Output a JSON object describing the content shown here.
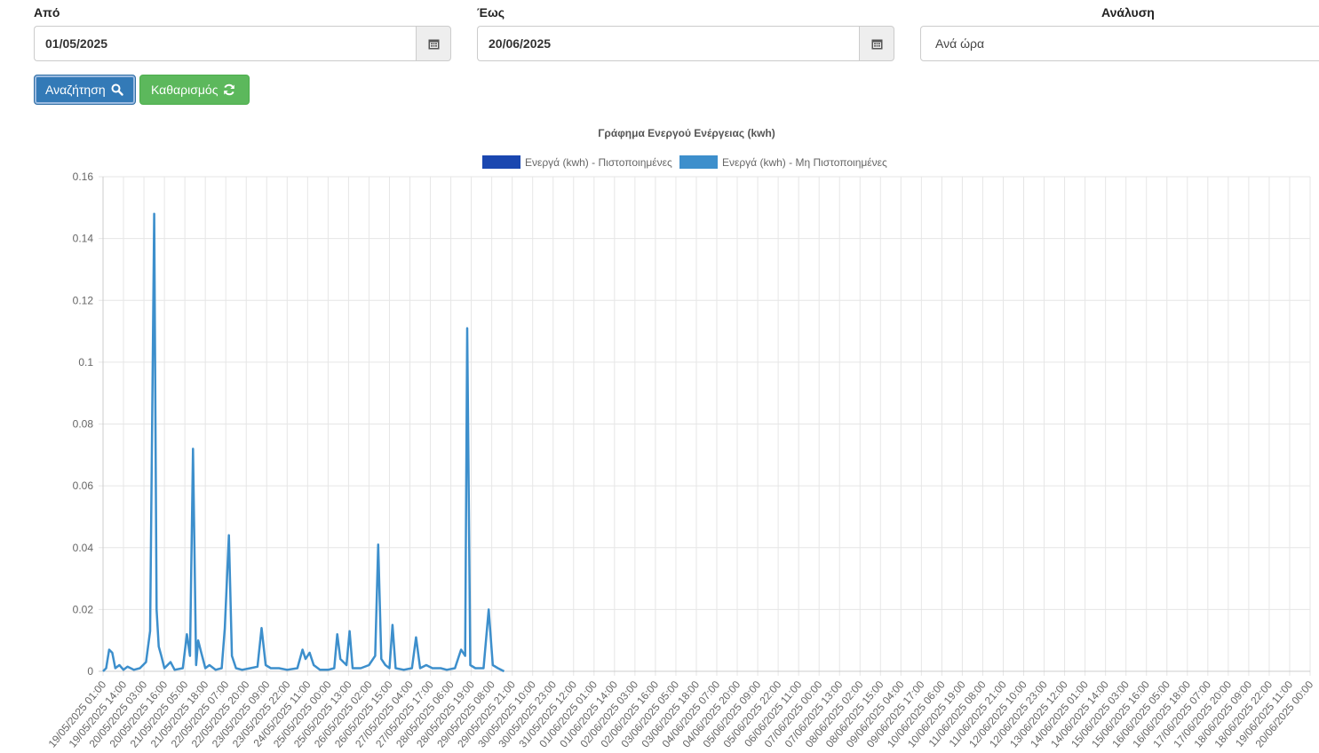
{
  "filters": {
    "from_label": "Από",
    "from_value": "01/05/2025",
    "to_label": "Έως",
    "to_value": "20/06/2025",
    "analysis_label": "Ανάλυση",
    "analysis_value": "Ανά ώρα"
  },
  "buttons": {
    "search_label": "Αναζήτηση",
    "clear_label": "Καθαρισμός"
  },
  "icons": [
    "calendar-icon",
    "search-icon",
    "refresh-icon"
  ],
  "chart_data": {
    "type": "line",
    "title": "Γράφημα Ενεργού Ενέργειας (kwh)",
    "legend_position": "top",
    "grid": true,
    "ylim": [
      0,
      0.16
    ],
    "yticks": [
      0,
      0.02,
      0.04,
      0.06,
      0.08,
      0.1,
      0.12,
      0.14,
      0.16
    ],
    "categories": [
      "19/05/2025 01:00",
      "19/05/2025 14:00",
      "20/05/2025 03:00",
      "20/05/2025 16:00",
      "21/05/2025 05:00",
      "21/05/2025 18:00",
      "22/05/2025 07:00",
      "22/05/2025 20:00",
      "23/05/2025 09:00",
      "23/05/2025 22:00",
      "24/05/2025 11:00",
      "25/05/2025 00:00",
      "25/05/2025 13:00",
      "26/05/2025 02:00",
      "26/05/2025 15:00",
      "27/05/2025 04:00",
      "27/05/2025 17:00",
      "28/05/2025 06:00",
      "28/05/2025 19:00",
      "29/05/2025 08:00",
      "29/05/2025 21:00",
      "30/05/2025 10:00",
      "30/05/2025 23:00",
      "31/05/2025 12:00",
      "01/06/2025 01:00",
      "01/06/2025 14:00",
      "02/06/2025 03:00",
      "02/06/2025 16:00",
      "03/06/2025 05:00",
      "03/06/2025 18:00",
      "04/06/2025 07:00",
      "04/06/2025 20:00",
      "05/06/2025 09:00",
      "05/06/2025 22:00",
      "06/06/2025 11:00",
      "07/06/2025 00:00",
      "07/06/2025 13:00",
      "08/06/2025 02:00",
      "08/06/2025 15:00",
      "09/06/2025 04:00",
      "09/06/2025 17:00",
      "10/06/2025 06:00",
      "10/06/2025 19:00",
      "11/06/2025 08:00",
      "11/06/2025 21:00",
      "12/06/2025 10:00",
      "12/06/2025 23:00",
      "13/06/2025 12:00",
      "14/06/2025 01:00",
      "14/06/2025 14:00",
      "15/06/2025 03:00",
      "15/06/2025 16:00",
      "16/06/2025 05:00",
      "16/06/2025 18:00",
      "17/06/2025 07:00",
      "17/06/2025 20:00",
      "18/06/2025 09:00",
      "18/06/2025 22:00",
      "19/06/2025 11:00",
      "20/06/2025 00:00"
    ],
    "series": [
      {
        "name": "Ενεργά (kwh) - Πιστοποιημένες",
        "color": "#1a47b0",
        "values": []
      },
      {
        "name": "Ενεργά (kwh) - Μη Πιστοποιημένες",
        "color": "#3d8fcc",
        "points": [
          [
            0,
            0
          ],
          [
            0.15,
            0.001
          ],
          [
            0.3,
            0.007
          ],
          [
            0.45,
            0.006
          ],
          [
            0.6,
            0.001
          ],
          [
            0.8,
            0.002
          ],
          [
            1.0,
            0.0005
          ],
          [
            1.2,
            0.0015
          ],
          [
            1.5,
            0.0005
          ],
          [
            1.8,
            0.001
          ],
          [
            2.1,
            0.003
          ],
          [
            2.3,
            0.013
          ],
          [
            2.5,
            0.148
          ],
          [
            2.62,
            0.02
          ],
          [
            2.72,
            0.008
          ],
          [
            2.85,
            0.005
          ],
          [
            3.0,
            0.001
          ],
          [
            3.3,
            0.003
          ],
          [
            3.5,
            0.0005
          ],
          [
            3.9,
            0.001
          ],
          [
            4.1,
            0.012
          ],
          [
            4.25,
            0.005
          ],
          [
            4.4,
            0.072
          ],
          [
            4.55,
            0.002
          ],
          [
            4.65,
            0.01
          ],
          [
            4.8,
            0.006
          ],
          [
            5.0,
            0.001
          ],
          [
            5.2,
            0.002
          ],
          [
            5.5,
            0.0005
          ],
          [
            5.8,
            0.001
          ],
          [
            5.95,
            0.014
          ],
          [
            6.15,
            0.044
          ],
          [
            6.3,
            0.005
          ],
          [
            6.5,
            0.001
          ],
          [
            6.8,
            0.0005
          ],
          [
            7.2,
            0.001
          ],
          [
            7.55,
            0.0015
          ],
          [
            7.75,
            0.014
          ],
          [
            7.95,
            0.002
          ],
          [
            8.2,
            0.001
          ],
          [
            8.6,
            0.001
          ],
          [
            9.0,
            0.0005
          ],
          [
            9.5,
            0.001
          ],
          [
            9.75,
            0.007
          ],
          [
            9.9,
            0.004
          ],
          [
            10.1,
            0.006
          ],
          [
            10.3,
            0.002
          ],
          [
            10.6,
            0.0005
          ],
          [
            11.0,
            0.0005
          ],
          [
            11.3,
            0.001
          ],
          [
            11.45,
            0.012
          ],
          [
            11.6,
            0.004
          ],
          [
            11.9,
            0.002
          ],
          [
            12.05,
            0.013
          ],
          [
            12.2,
            0.001
          ],
          [
            12.6,
            0.001
          ],
          [
            13.0,
            0.002
          ],
          [
            13.3,
            0.005
          ],
          [
            13.45,
            0.041
          ],
          [
            13.6,
            0.004
          ],
          [
            13.8,
            0.002
          ],
          [
            14.0,
            0.001
          ],
          [
            14.15,
            0.015
          ],
          [
            14.3,
            0.001
          ],
          [
            14.7,
            0.0005
          ],
          [
            15.1,
            0.001
          ],
          [
            15.3,
            0.011
          ],
          [
            15.5,
            0.001
          ],
          [
            15.8,
            0.002
          ],
          [
            16.1,
            0.001
          ],
          [
            16.5,
            0.001
          ],
          [
            16.8,
            0.0005
          ],
          [
            17.2,
            0.001
          ],
          [
            17.5,
            0.007
          ],
          [
            17.7,
            0.005
          ],
          [
            17.8,
            0.111
          ],
          [
            17.95,
            0.002
          ],
          [
            18.2,
            0.001
          ],
          [
            18.6,
            0.001
          ],
          [
            18.85,
            0.02
          ],
          [
            19.05,
            0.002
          ],
          [
            19.3,
            0.001
          ],
          [
            19.6,
            0
          ]
        ]
      }
    ]
  }
}
